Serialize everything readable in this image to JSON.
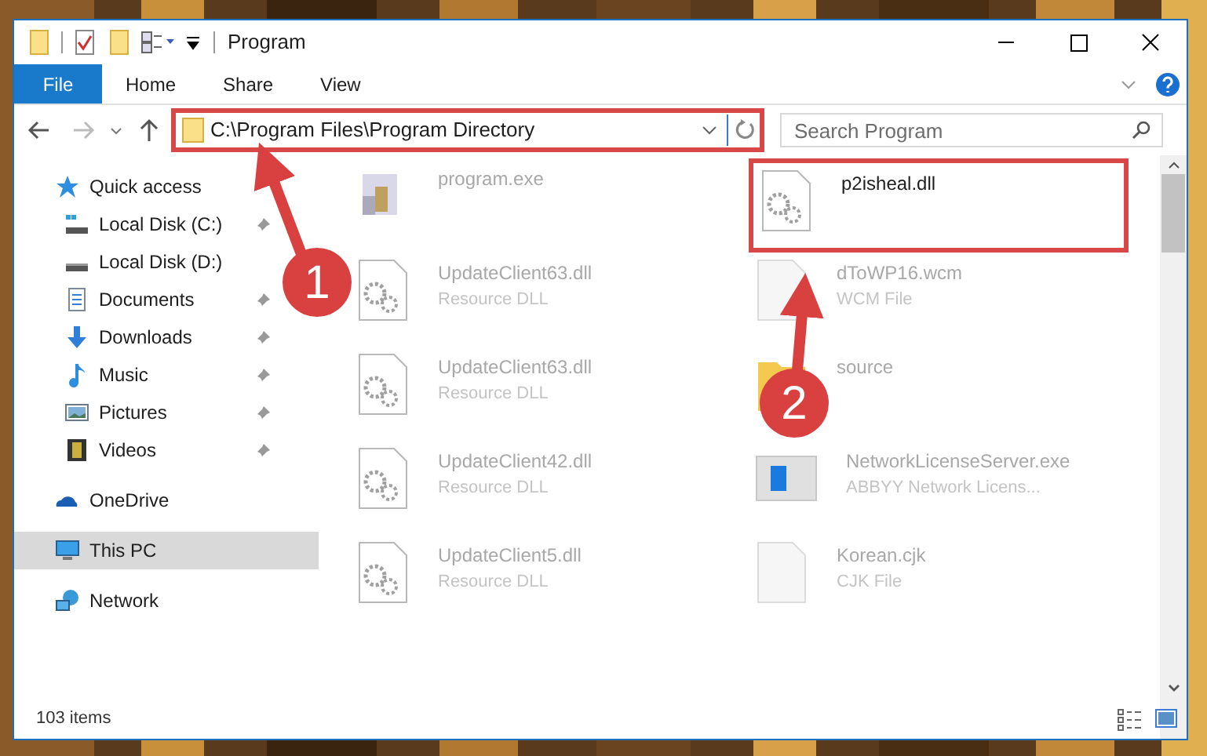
{
  "window": {
    "title": "Program"
  },
  "ribbon": {
    "tabs": [
      {
        "label": "File",
        "kind": "file",
        "selected": false
      },
      {
        "label": "Home",
        "kind": "tab",
        "selected": false
      },
      {
        "label": "Share",
        "kind": "tab",
        "selected": false
      },
      {
        "label": "View",
        "kind": "tab",
        "selected": false
      }
    ]
  },
  "address_bar": {
    "path": "C:\\Program Files\\Program Directory",
    "highlighted": true
  },
  "search": {
    "placeholder": "Search Program"
  },
  "sidebar": {
    "items": [
      {
        "label": "Quick access",
        "kind": "star",
        "selected": false,
        "children": [
          {
            "label": "Local Disk (C:)",
            "kind": "disk-c",
            "pinned": true,
            "selected": false
          },
          {
            "label": "Local Disk (D:)",
            "kind": "disk",
            "pinned": false,
            "selected": false
          },
          {
            "label": "Documents",
            "kind": "documents",
            "pinned": true,
            "selected": false
          },
          {
            "label": "Downloads",
            "kind": "downloads",
            "pinned": true,
            "selected": false
          },
          {
            "label": "Music",
            "kind": "music",
            "pinned": true,
            "selected": false
          },
          {
            "label": "Pictures",
            "kind": "pictures",
            "pinned": true,
            "selected": false
          },
          {
            "label": "Videos",
            "kind": "videos",
            "pinned": true,
            "selected": false
          }
        ]
      },
      {
        "label": "OneDrive",
        "kind": "cloud",
        "selected": false
      },
      {
        "label": "This PC",
        "kind": "pc",
        "selected": true
      },
      {
        "label": "Network",
        "kind": "network",
        "selected": false
      }
    ]
  },
  "files": [
    {
      "name": "program.exe",
      "kind": "program",
      "highlighted": false
    },
    {
      "name": "p2isheal.dll",
      "kind": "dll",
      "highlighted": true
    },
    {
      "name": "UpdateClient63.dll",
      "type": "Resource DLL",
      "kind": "dll",
      "highlighted": false
    },
    {
      "name": "dToWP16.wcm",
      "type": "WCM File",
      "kind": "file",
      "highlighted": false
    },
    {
      "name": "UpdateClient63.dll",
      "type": "Resource DLL",
      "kind": "dll",
      "highlighted": false
    },
    {
      "name": "source",
      "kind": "folder",
      "highlighted": false
    },
    {
      "name": "UpdateClient42.dll",
      "type": "Resource DLL",
      "kind": "dll",
      "highlighted": false
    },
    {
      "name": "NetworkLicenseServer.exe",
      "type": "ABBYY Network Licens...",
      "kind": "app",
      "highlighted": false
    },
    {
      "name": "UpdateClient5.dll",
      "type": "Resource DLL",
      "kind": "dll",
      "highlighted": false
    },
    {
      "name": "Korean.cjk",
      "type": "CJK File",
      "kind": "file",
      "highlighted": false
    }
  ],
  "status_bar": {
    "count": "103 items"
  },
  "annotations": [
    {
      "label": "1"
    },
    {
      "label": "2"
    }
  ]
}
